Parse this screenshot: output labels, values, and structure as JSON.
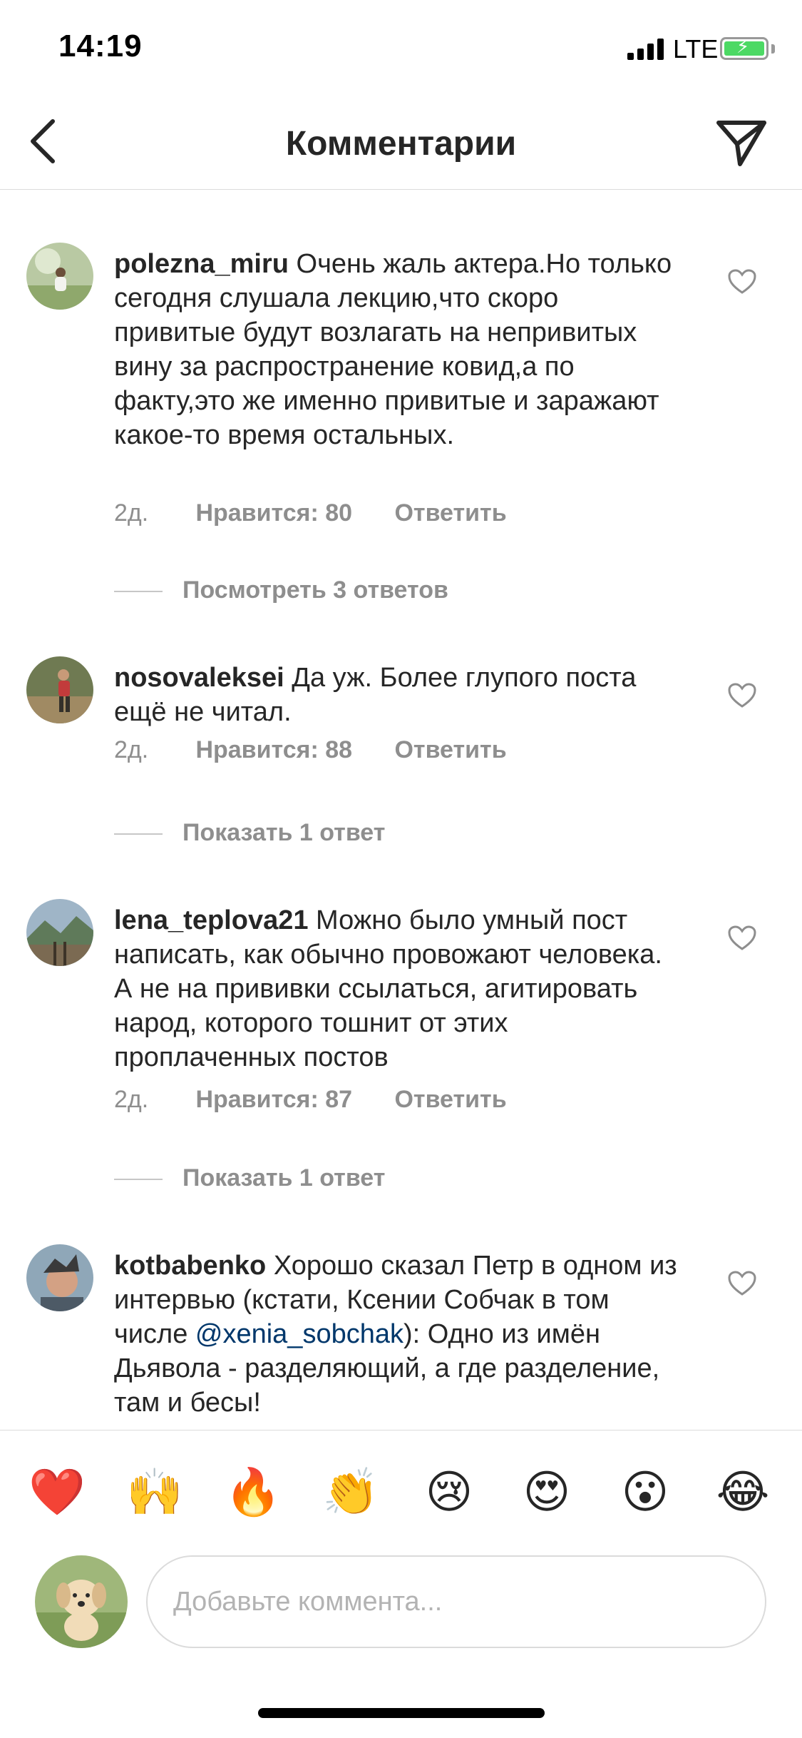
{
  "status_bar": {
    "time": "14:19",
    "network": "LTE"
  },
  "header": {
    "title": "Комментарии"
  },
  "comments": [
    {
      "username": "polezna_miru",
      "text": "Очень жаль актера.Но только сегодня слушала лекцию,что скоро привитые будут возлагать на непривитых вину за распространение ковид,а по факту,это же именно привитые и заражают какое-то время остальных.",
      "time": "2д.",
      "likes": "Нравится: 80",
      "reply": "Ответить",
      "replies_label": "Посмотреть 3 ответов"
    },
    {
      "username": "nosovaleksei",
      "text": "Да уж. Более глупого поста ещё не читал.",
      "time": "2д.",
      "likes": "Нравится: 88",
      "reply": "Ответить",
      "replies_label": "Показать 1 ответ"
    },
    {
      "username": "lena_teplova21",
      "text": "Можно было умный пост написать, как обычно провожают человека. А не на прививки ссылаться, агитировать народ, которого тошнит от этих проплаченных постов",
      "time": "2д.",
      "likes": "Нравится: 87",
      "reply": "Ответить",
      "replies_label": "Показать 1 ответ"
    },
    {
      "username": "kotbabenko",
      "text_before": "Хорошо сказал Петр в одном из интервью (кстати, Ксении Собчак в том числе ",
      "mention": "@xenia_sobchak",
      "text_after": "): Одно из имён Дьявола - разделяющий, а где разделение, там и бесы!"
    }
  ],
  "emoji_bar": [
    "❤️",
    "🙌",
    "🔥",
    "👏",
    "😢",
    "😍",
    "😮",
    "😂"
  ],
  "composer": {
    "placeholder": "Добавьте коммента..."
  },
  "colors": {
    "text": "#262626",
    "secondary": "#8e8e8e",
    "mention": "#00376b",
    "divider": "#dbdbdb"
  }
}
